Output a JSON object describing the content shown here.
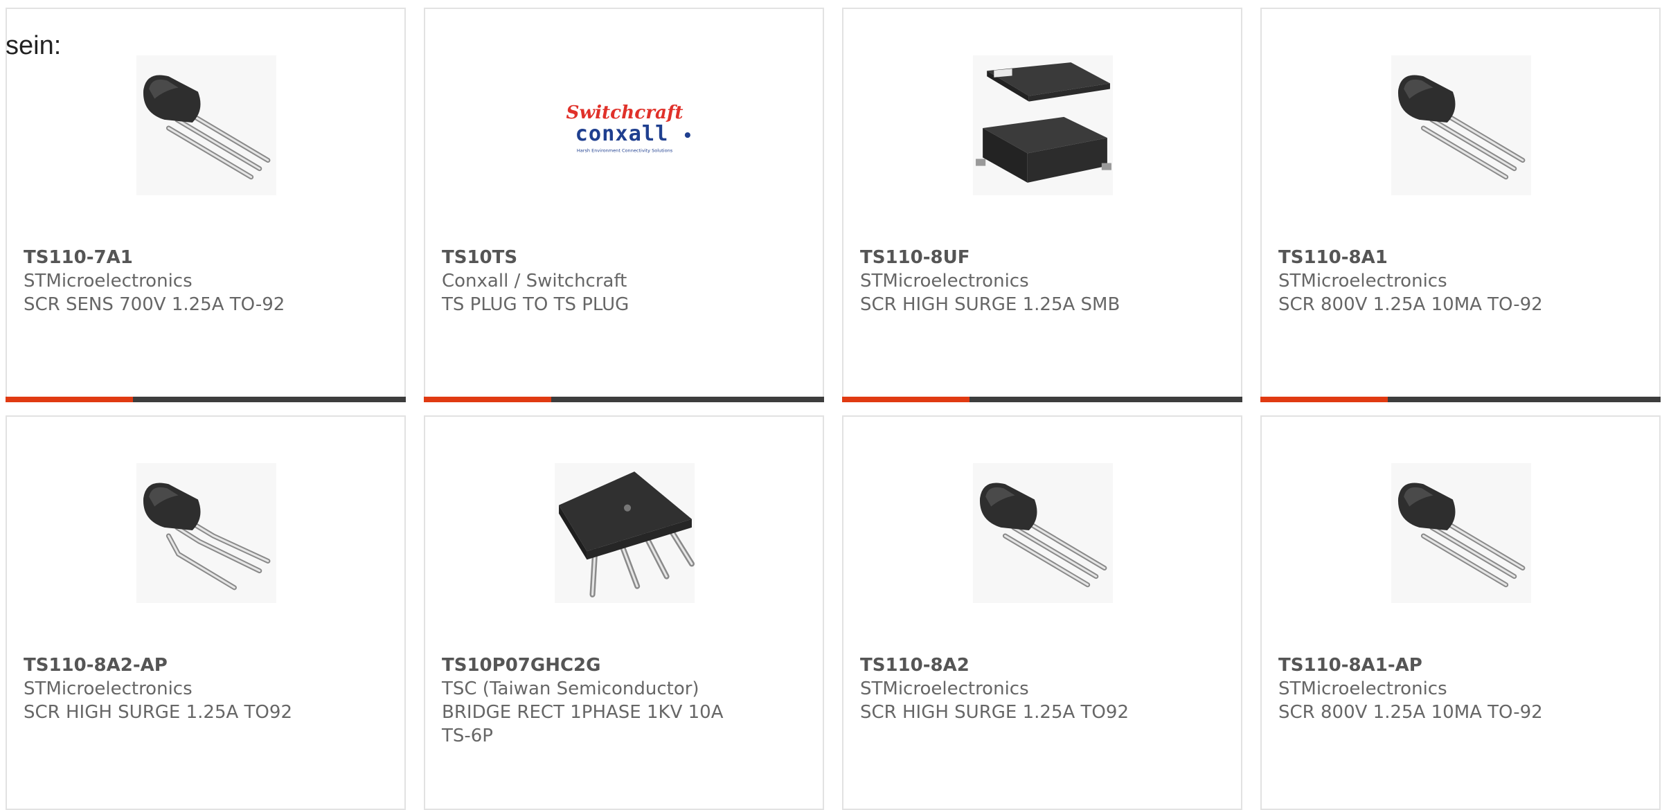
{
  "intro_text": "sein:",
  "colors": {
    "accent": "#e03a12",
    "bar": "#3d3d3d",
    "border": "#e2e2e2"
  },
  "logo": {
    "line1": "Switchcraft",
    "line2": "conxall",
    "tagline": "Harsh Environment Connectivity Solutions"
  },
  "products": [
    {
      "part": "TS110-7A1",
      "manufacturer": "STMicroelectronics",
      "description": "SCR SENS 700V 1.25A TO-92",
      "image": "to92-transistor-icon"
    },
    {
      "part": "TS10TS",
      "manufacturer": "Conxall / Switchcraft",
      "description": "TS PLUG TO TS PLUG",
      "image": "switchcraft-conxall-logo"
    },
    {
      "part": "TS110-8UF",
      "manufacturer": "STMicroelectronics",
      "description": "SCR HIGH SURGE 1.25A SMB",
      "image": "smb-package-icon"
    },
    {
      "part": "TS110-8A1",
      "manufacturer": "STMicroelectronics",
      "description": "SCR 800V 1.25A 10MA TO-92",
      "image": "to92-transistor-icon"
    },
    {
      "part": "TS110-8A2-AP",
      "manufacturer": "STMicroelectronics",
      "description": "SCR HIGH SURGE 1.25A TO92",
      "image": "to92-bent-leads-icon"
    },
    {
      "part": "TS10P07GHC2G",
      "manufacturer": "TSC (Taiwan Semiconductor)",
      "description": "BRIDGE RECT 1PHASE 1KV 10A TS-6P",
      "image": "bridge-rectifier-icon"
    },
    {
      "part": "TS110-8A2",
      "manufacturer": "STMicroelectronics",
      "description": "SCR HIGH SURGE 1.25A TO92",
      "image": "to92-transistor-icon"
    },
    {
      "part": "TS110-8A1-AP",
      "manufacturer": "STMicroelectronics",
      "description": "SCR 800V 1.25A 10MA TO-92",
      "image": "to92-transistor-icon"
    }
  ]
}
